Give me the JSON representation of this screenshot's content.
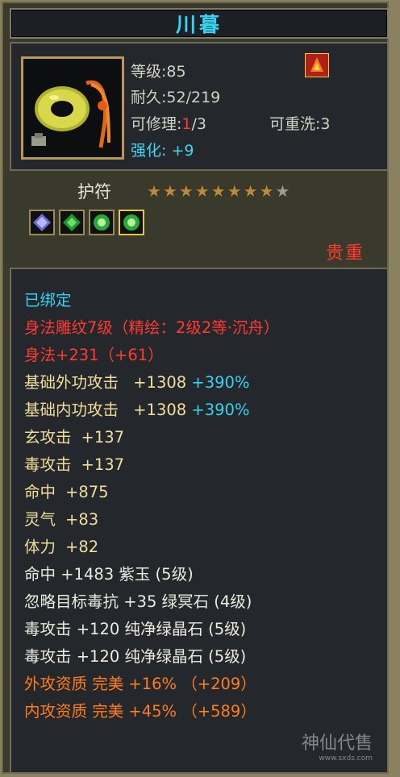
{
  "header": {
    "title": "川暮"
  },
  "info": {
    "level": "等级:85",
    "durability": "耐久:52/219",
    "repair_label": "可修理:",
    "repair_current": "1",
    "repair_total": "/3",
    "rewash": "可重洗:3",
    "enhance": "强化: +9"
  },
  "amulet": {
    "label": "护符",
    "stars_total": 9,
    "stars_lit": 8,
    "gems": [
      "blue-diamond-gem",
      "green-gem",
      "green-gem",
      "green-gem"
    ],
    "precious": "贵重"
  },
  "attributes": {
    "bound": "已绑定",
    "carve": "身法雕纹7级（精绘：2级2等·沉舟）",
    "agility": "身法+231（+61）",
    "ext_attack_label": "基础外功攻击",
    "ext_attack_val": "+1308",
    "ext_attack_pct": "+390%",
    "int_attack_label": "基础内功攻击",
    "int_attack_val": "+1308",
    "int_attack_pct": "+390%",
    "mystic_label": "玄攻击",
    "mystic_val": "+137",
    "poison_label": "毒攻击",
    "poison_val": "+137",
    "hit_label": "命中",
    "hit_val": "+875",
    "spirit_label": "灵气",
    "spirit_val": "+83",
    "stamina_label": "体力",
    "stamina_val": "+82",
    "gem_hit": "命中  +1483  紫玉 (5级)",
    "gem_resist": "忽略目标毒抗  +35  绿冥石 (4级)",
    "gem_poison1": "毒攻击  +120  纯净绿晶石 (5级)",
    "gem_poison2": "毒攻击  +120  纯净绿晶石 (5级)",
    "ext_quality": "外攻资质   完美  +16% （+209）",
    "int_quality": "内攻资质   完美  +45% （+589）"
  },
  "watermark": {
    "brand": "神仙代售",
    "url": "www.sxds.com"
  }
}
